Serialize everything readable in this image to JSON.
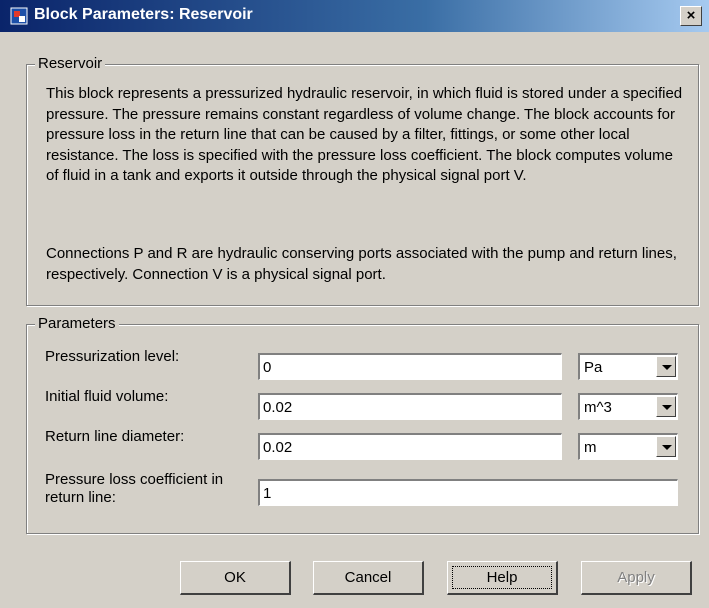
{
  "window": {
    "title": "Block Parameters: Reservoir",
    "close_label": "×"
  },
  "description_group": {
    "legend": "Reservoir",
    "paragraph1": "This block represents a pressurized hydraulic reservoir, in which fluid is stored under a specified pressure. The pressure remains constant regardless of volume change. The block accounts for pressure loss in the return line that can be caused by a filter, fittings, or some other local resistance. The loss is specified with the pressure loss coefficient. The block computes volume of fluid in a tank and exports it outside through the physical signal port V.",
    "paragraph2": "Connections P and R are hydraulic conserving ports associated with the pump and return lines, respectively. Connection V is a physical signal port."
  },
  "parameters_group": {
    "legend": "Parameters",
    "rows": [
      {
        "label": "Pressurization level:",
        "value": "0",
        "unit": "Pa"
      },
      {
        "label": "Initial fluid volume:",
        "value": "0.02",
        "unit": "m^3"
      },
      {
        "label": "Return line diameter:",
        "value": "0.02",
        "unit": "m"
      },
      {
        "label": "Pressure loss coefficient in return line:",
        "value": "1"
      }
    ]
  },
  "buttons": {
    "ok": "OK",
    "cancel": "Cancel",
    "help": "Help",
    "apply": "Apply"
  }
}
